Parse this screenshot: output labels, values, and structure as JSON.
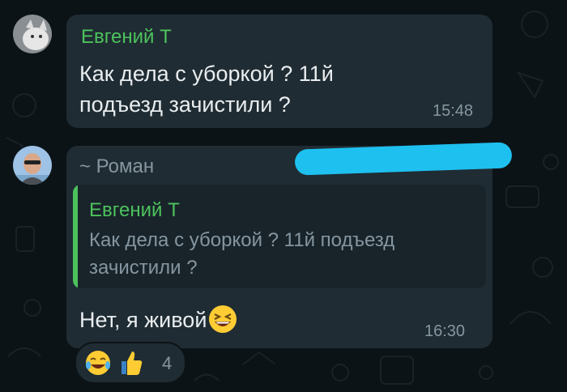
{
  "messages": [
    {
      "sender": "Евгений Т",
      "text": "Как дела с уборкой ? 11й подъезд зачистили ?",
      "time": "15:48"
    },
    {
      "sender": "~ Роман",
      "quote": {
        "sender": "Евгений Т",
        "text": "Как дела с уборкой ? 11й подъезд зачистили ?"
      },
      "text": "Нет, я живой",
      "time": "16:30",
      "reactions": {
        "count": "4"
      }
    }
  ],
  "colors": {
    "background": "#0c1317",
    "bubble": "#1f2c33",
    "sender_name": "#4dc25c",
    "text": "#e9edef",
    "meta": "#8696a0",
    "redaction": "#1ec0f0"
  }
}
